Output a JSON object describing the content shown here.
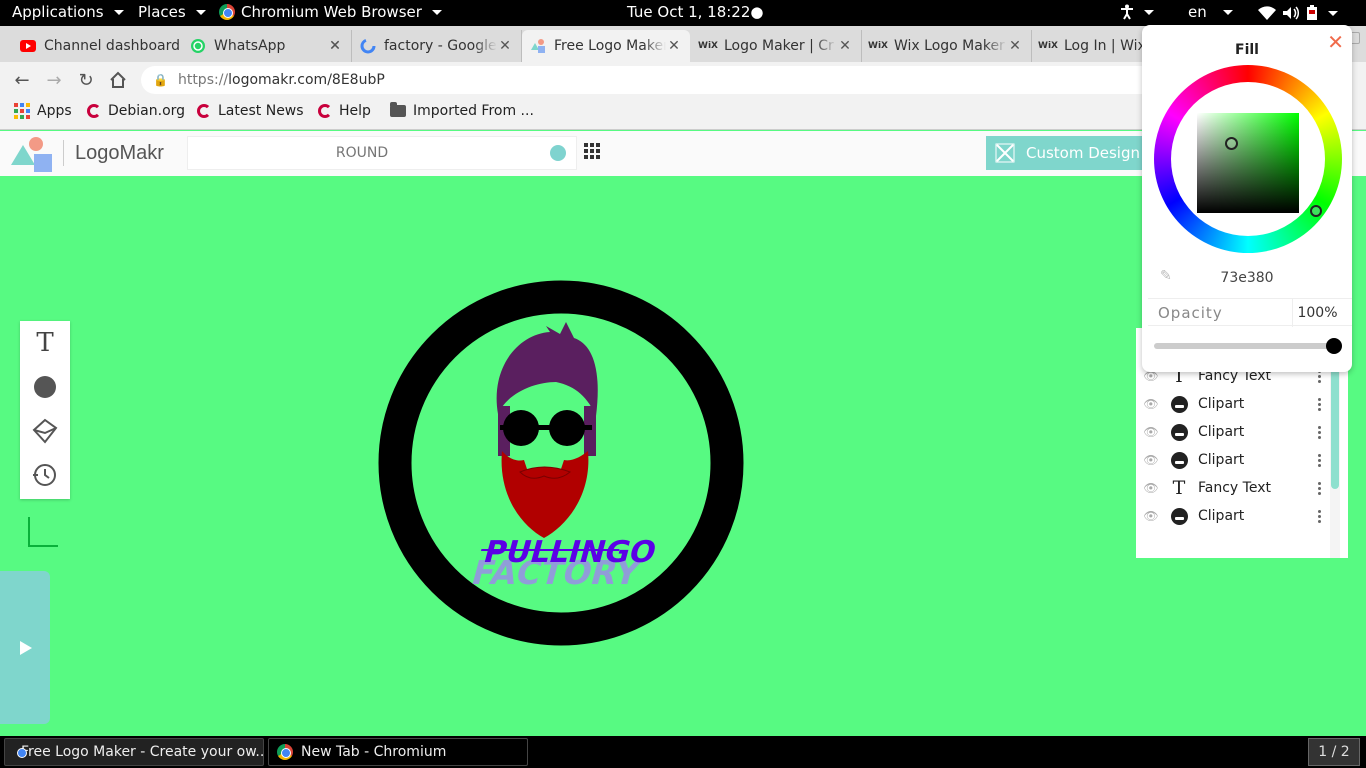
{
  "topbar": {
    "applications": "Applications",
    "places": "Places",
    "browser": "Chromium Web Browser",
    "clock": "Tue Oct  1, 18:22●",
    "lang": "en"
  },
  "tabs": [
    {
      "title": "Channel dashboard",
      "favicon": "youtube-icon"
    },
    {
      "title": "WhatsApp",
      "favicon": "whatsapp-icon"
    },
    {
      "title": "factory - Google",
      "favicon": "google-icon"
    },
    {
      "title": "Free Logo Maker",
      "favicon": "logomakr-icon"
    },
    {
      "title": "Logo Maker | Cr",
      "favicon": "wix-icon"
    },
    {
      "title": "Wix Logo Maker",
      "favicon": "wix-icon"
    },
    {
      "title": "Log In | Wix",
      "favicon": "wix-icon"
    }
  ],
  "wix_favicon_text": "WiX",
  "toolbar": {
    "url_scheme": "https://",
    "url_rest": "logomakr.com/8E8ubP"
  },
  "bookmarks": {
    "apps": "Apps",
    "debian": "Debian.org",
    "news": "Latest News",
    "help": "Help",
    "imported": "Imported From ..."
  },
  "app": {
    "brand": "LogoMakr",
    "search_placeholder": "ROUND",
    "custom_design": "Custom Design Services"
  },
  "logo": {
    "line1": "PULLINGO",
    "line2": "FACTORY"
  },
  "fill_panel": {
    "title": "Fill",
    "close": "✕",
    "hex": "73e380",
    "opacity_label": "Opacity",
    "opacity_value": "100%",
    "opacity_fraction": 1.0
  },
  "layers": [
    {
      "name": "Clipart",
      "kind": "clipart"
    },
    {
      "name": "Fancy Text",
      "kind": "text"
    },
    {
      "name": "Clipart",
      "kind": "clipart"
    },
    {
      "name": "Clipart",
      "kind": "clipart"
    },
    {
      "name": "Clipart",
      "kind": "clipart"
    },
    {
      "name": "Fancy Text",
      "kind": "text"
    },
    {
      "name": "Clipart",
      "kind": "clipart"
    }
  ],
  "taskbar": {
    "task1": "Free Logo Maker - Create your ow...",
    "task2": "New Tab - Chromium",
    "workspace": "1 / 2"
  },
  "colors": {
    "canvas": "#57fa82",
    "accent": "#7fd6cc",
    "hair": "#5a1f5f",
    "beard": "#b10000",
    "text1": "#5b00e6",
    "text2": "#9b8de8"
  }
}
